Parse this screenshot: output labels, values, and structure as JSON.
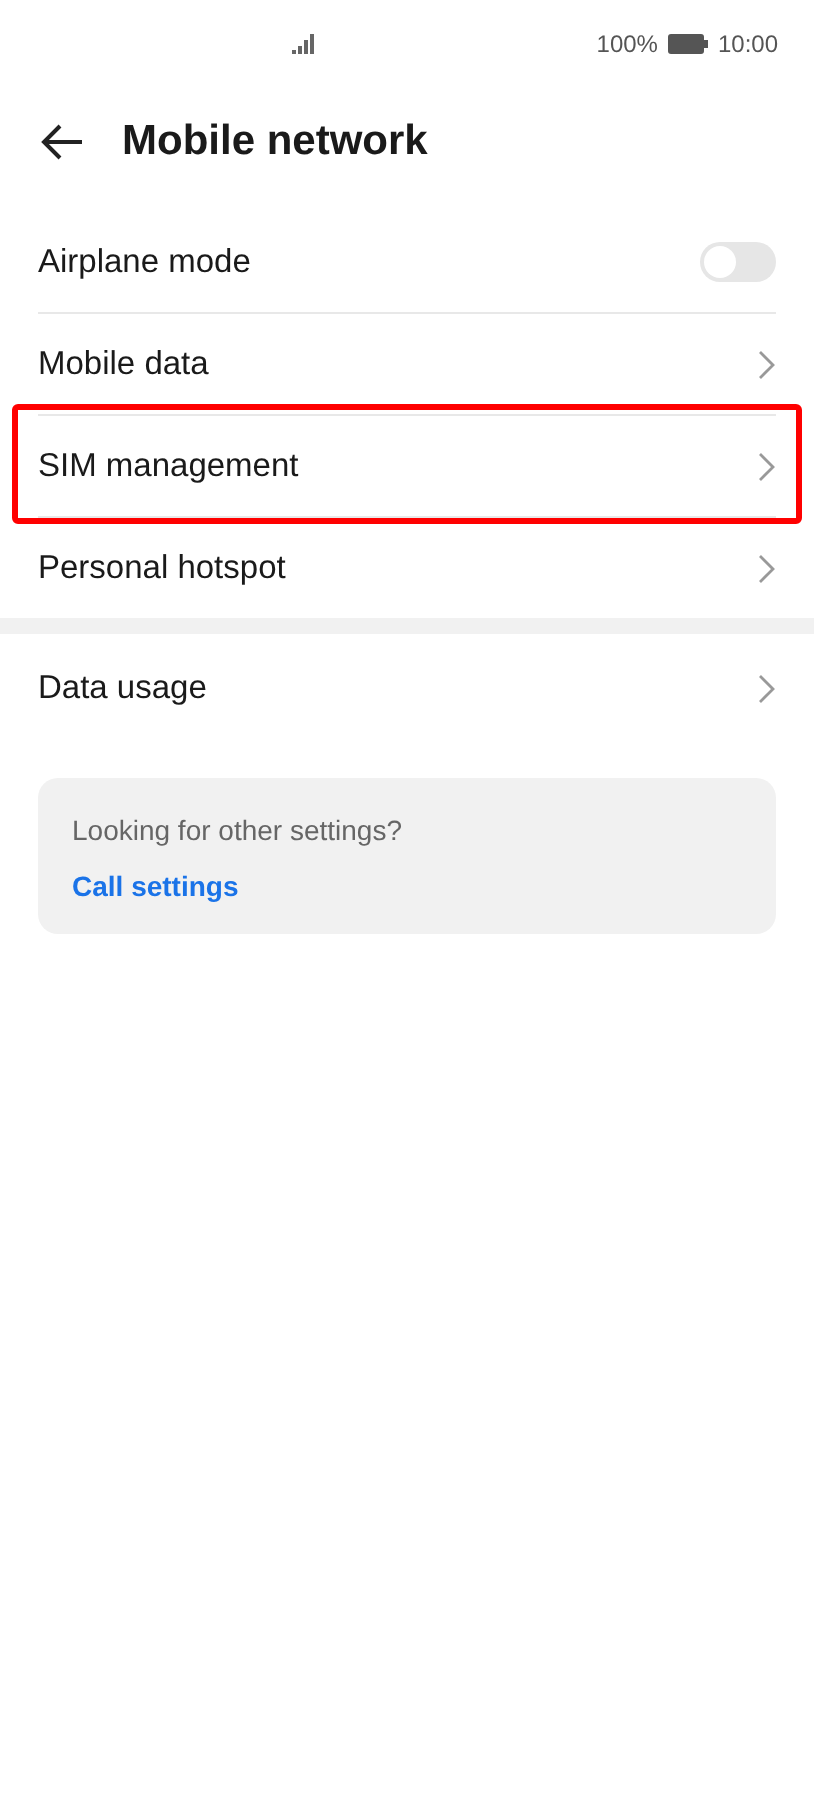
{
  "status_bar": {
    "battery": "100%",
    "time": "10:00"
  },
  "header": {
    "title": "Mobile network"
  },
  "groups": [
    {
      "items": [
        {
          "kind": "toggle",
          "label": "Airplane mode",
          "on": false,
          "highlighted": false
        },
        {
          "kind": "link",
          "label": "Mobile data",
          "highlighted": false
        },
        {
          "kind": "link",
          "label": "SIM management",
          "highlighted": true
        },
        {
          "kind": "link",
          "label": "Personal hotspot",
          "highlighted": false
        }
      ]
    },
    {
      "items": [
        {
          "kind": "link",
          "label": "Data usage",
          "highlighted": false
        }
      ]
    }
  ],
  "suggestion": {
    "question": "Looking for other settings?",
    "link": "Call settings"
  }
}
